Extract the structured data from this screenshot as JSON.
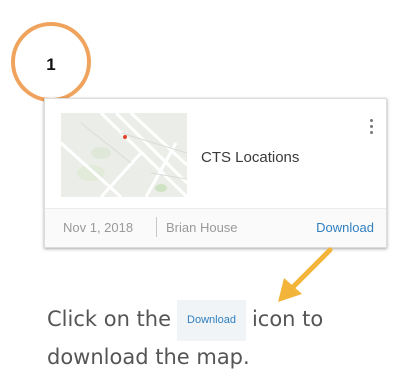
{
  "step": {
    "number": "1"
  },
  "card": {
    "title": "CTS Locations",
    "date": "Nov 1, 2018",
    "author": "Brian House",
    "download_label": "Download",
    "menu_icon": "kebab-menu-icon",
    "thumbnail_icon": "map-thumbnail"
  },
  "instruction": {
    "before": "Click on the",
    "button_label": "Download",
    "after": "icon to download the map."
  },
  "colors": {
    "step_circle": "#f0a35c",
    "arrow": "#f3b43a",
    "link_blue": "#2f7fc1"
  }
}
